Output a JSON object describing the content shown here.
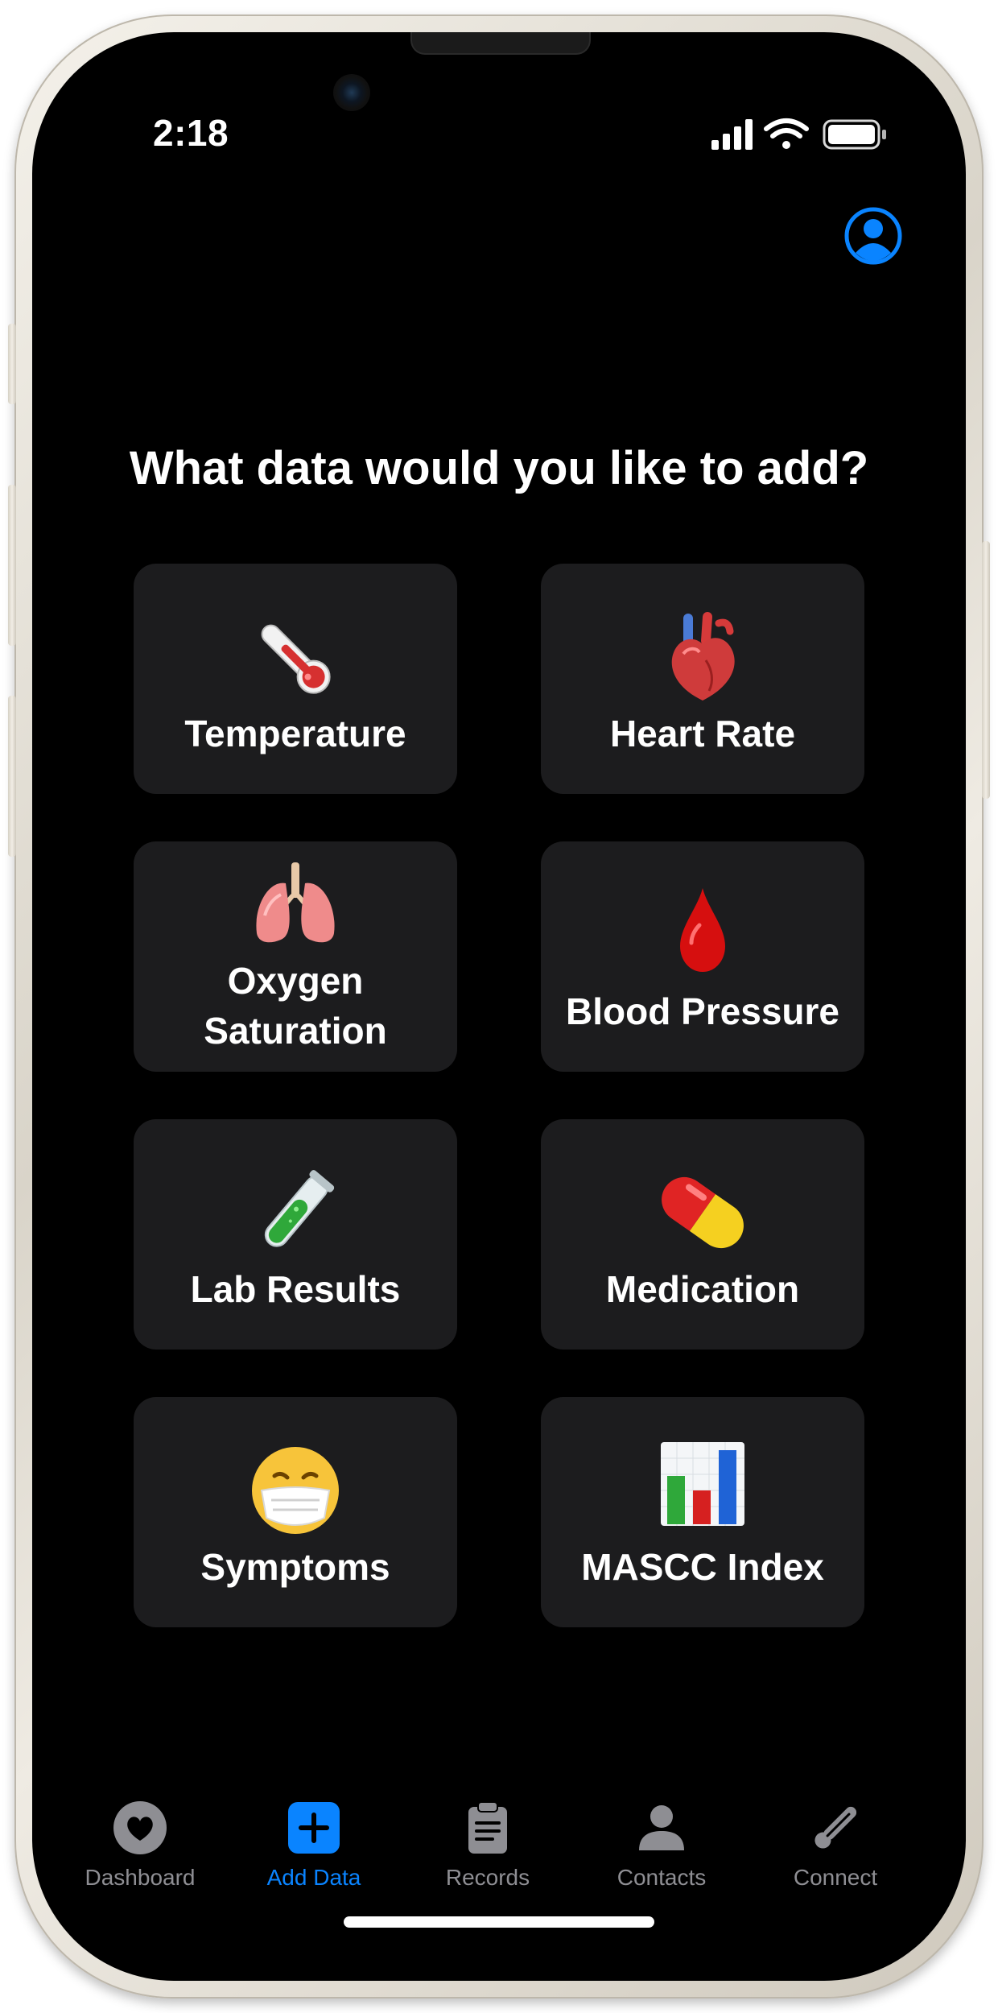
{
  "status_bar": {
    "time": "2:18",
    "icons": [
      "cellular-signal-icon",
      "wifi-icon",
      "battery-icon"
    ]
  },
  "header": {
    "profile_icon": "person-circle-icon"
  },
  "main": {
    "title": "What data would you like to add?",
    "tiles": [
      {
        "label": "Temperature",
        "icon": "thermometer-icon"
      },
      {
        "label": "Heart Rate",
        "icon": "anatomical-heart-icon"
      },
      {
        "label": "Oxygen\nSaturation",
        "icon": "lungs-icon"
      },
      {
        "label": "Blood Pressure",
        "icon": "drop-of-blood-icon"
      },
      {
        "label": "Lab Results",
        "icon": "test-tube-icon"
      },
      {
        "label": "Medication",
        "icon": "pill-icon"
      },
      {
        "label": "Symptoms",
        "icon": "face-with-medical-mask-icon"
      },
      {
        "label": "MASCC Index",
        "icon": "bar-chart-icon"
      }
    ]
  },
  "tab_bar": {
    "tabs": [
      {
        "label": "Dashboard",
        "icon": "heart-circle-icon",
        "active": false
      },
      {
        "label": "Add Data",
        "icon": "plus-square-icon",
        "active": true
      },
      {
        "label": "Records",
        "icon": "clipboard-icon",
        "active": false
      },
      {
        "label": "Contacts",
        "icon": "person-icon",
        "active": false
      },
      {
        "label": "Connect",
        "icon": "thermometer-icon",
        "active": false
      }
    ]
  },
  "colors": {
    "background": "#000000",
    "tile": "#1c1c1e",
    "accent": "#0a84ff",
    "inactive": "#8e8e93",
    "text": "#ffffff"
  }
}
